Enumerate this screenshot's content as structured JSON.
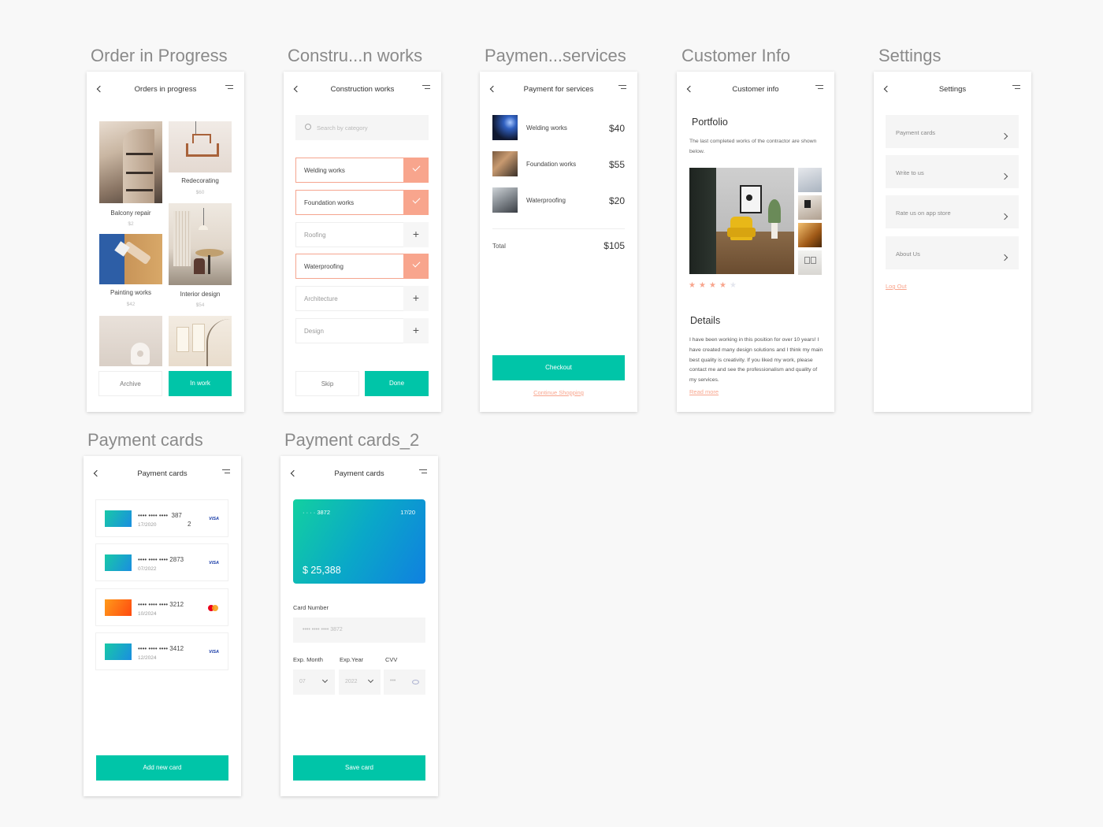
{
  "frames": {
    "orders": "Order in Progress",
    "construction": "Constru...n works",
    "payment": "Paymen...services",
    "customer": "Customer Info",
    "settings": "Settings",
    "cards": "Payment cards",
    "cards2": "Payment cards_2"
  },
  "orders": {
    "title": "Orders in progress",
    "items": [
      {
        "name": "Balcony repair",
        "price": "$2"
      },
      {
        "name": "Redecorating",
        "price": "$60"
      },
      {
        "name": "Painting works",
        "price": "$42"
      },
      {
        "name": "Interior design",
        "price": "$54"
      }
    ],
    "archive_label": "Archive",
    "inwork_label": "In work"
  },
  "construction": {
    "title": "Construction works",
    "search_placeholder": "Search by category",
    "categories": [
      {
        "label": "Welding works",
        "selected": true
      },
      {
        "label": "Foundation works",
        "selected": true
      },
      {
        "label": "Roofing",
        "selected": false
      },
      {
        "label": "Waterproofing",
        "selected": true
      },
      {
        "label": "Architecture",
        "selected": false
      },
      {
        "label": "Design",
        "selected": false
      }
    ],
    "skip_label": "Skip",
    "done_label": "Done"
  },
  "payment": {
    "title": "Payment for services",
    "items": [
      {
        "name": "Welding works",
        "amount": "$40"
      },
      {
        "name": "Foundation works",
        "amount": "$55"
      },
      {
        "name": "Waterproofing",
        "amount": "$20"
      }
    ],
    "total_label": "Total",
    "total_amount": "$105",
    "checkout_label": "Checkout",
    "continue_label": "Continue Shopping"
  },
  "customer": {
    "title": "Customer info",
    "portfolio_heading": "Portfolio",
    "portfolio_text": "The last completed works of the contractor are shown below.",
    "rating": 4,
    "rating_max": 5,
    "details_heading": "Details",
    "details_text": "I have been working in this position for over 10 years! I have created many design solutions and I think my main best quality is creativity. If you liked my work, please contact me and see the professionalism and quality of my services.",
    "read_more": "Read more"
  },
  "settings": {
    "title": "Settings",
    "items": [
      {
        "label": "Payment cards"
      },
      {
        "label": "Write to us"
      },
      {
        "label": "Rate us on app store"
      },
      {
        "label": "About Us"
      }
    ],
    "logout_label": "Log Out"
  },
  "cards": {
    "title": "Payment cards",
    "list": [
      {
        "number": "•••• •••• ••••  387\n2",
        "number_a": "•••• •••• ••••",
        "number_b": "387",
        "number_c": "2",
        "expiry": "17/2020",
        "brand": "VISA",
        "color": "teal"
      },
      {
        "number_a": "•••• •••• ••••",
        "number_b": "2873",
        "expiry": "07/2022",
        "brand": "VISA",
        "color": "teal"
      },
      {
        "number_a": "•••• •••• ••••",
        "number_b": "3212",
        "expiry": "10/2024",
        "brand": "mastercard",
        "color": "orange"
      },
      {
        "number_a": "•••• •••• ••••",
        "number_b": "3412",
        "expiry": "12/2024",
        "brand": "VISA",
        "color": "teal"
      }
    ],
    "add_label": "Add new card"
  },
  "cards2": {
    "title": "Payment cards",
    "card_number": "· · · ·  3872",
    "card_expiry": "17/20",
    "card_balance": "$ 25,388",
    "card_number_label": "Card Number",
    "card_number_value": "•••• •••• •••• 3872",
    "exp_month_label": "Exp. Month",
    "exp_year_label": "Exp.Year",
    "cvv_label": "CVV",
    "exp_month_value": "07",
    "exp_year_value": "2022",
    "cvv_value": "•••",
    "save_label": "Save card"
  },
  "colors": {
    "teal": "#00c5a8",
    "salmon": "#f8a58d",
    "star": "#f8a58d"
  }
}
